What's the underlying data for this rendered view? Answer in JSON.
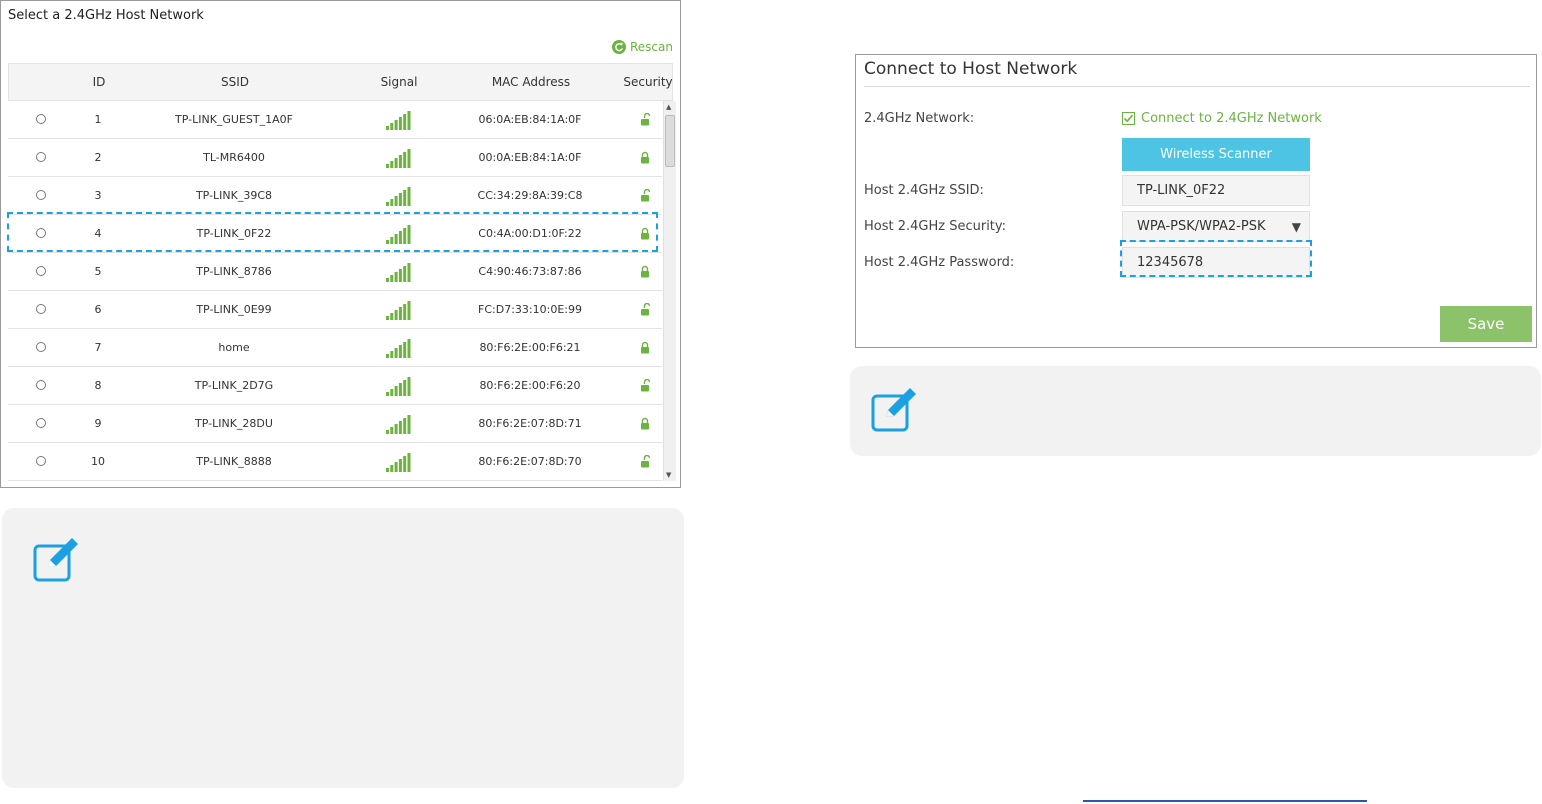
{
  "scanner": {
    "title": "Select a 2.4GHz Host Network",
    "rescan_label": "Rescan",
    "columns": [
      "ID",
      "SSID",
      "Signal",
      "MAC Address",
      "Security"
    ],
    "rows": [
      {
        "id": "1",
        "ssid": "TP-LINK_GUEST_1A0F",
        "mac": "06:0A:EB:84:1A:0F",
        "security": "unlocked"
      },
      {
        "id": "2",
        "ssid": "TL-MR6400",
        "mac": "00:0A:EB:84:1A:0F",
        "security": "locked"
      },
      {
        "id": "3",
        "ssid": "TP-LINK_39C8",
        "mac": "CC:34:29:8A:39:C8",
        "security": "unlocked"
      },
      {
        "id": "4",
        "ssid": "TP-LINK_0F22",
        "mac": "C0:4A:00:D1:0F:22",
        "security": "locked"
      },
      {
        "id": "5",
        "ssid": "TP-LINK_8786",
        "mac": "C4:90:46:73:87:86",
        "security": "locked"
      },
      {
        "id": "6",
        "ssid": "TP-LINK_0E99",
        "mac": "FC:D7:33:10:0E:99",
        "security": "unlocked"
      },
      {
        "id": "7",
        "ssid": "home",
        "mac": "80:F6:2E:00:F6:21",
        "security": "locked"
      },
      {
        "id": "8",
        "ssid": "TP-LINK_2D7G",
        "mac": "80:F6:2E:00:F6:20",
        "security": "unlocked"
      },
      {
        "id": "9",
        "ssid": "TP-LINK_28DU",
        "mac": "80:F6:2E:07:8D:71",
        "security": "locked"
      },
      {
        "id": "10",
        "ssid": "TP-LINK_8888",
        "mac": "80:F6:2E:07:8D:70",
        "security": "unlocked"
      }
    ],
    "selected_id": "4"
  },
  "connect": {
    "title": "Connect to Host Network",
    "network_label": "2.4GHz Network:",
    "connect_checkbox_label": "Connect to 2.4GHz Network",
    "connect_checked": true,
    "wireless_scanner_label": "Wireless Scanner",
    "ssid_label": "Host 2.4GHz SSID:",
    "ssid_value": "TP-LINK_0F22",
    "security_label": "Host 2.4GHz Security:",
    "security_value": "WPA-PSK/WPA2-PSK",
    "password_label": "Host 2.4GHz Password:",
    "password_value": "12345678",
    "save_label": "Save"
  },
  "colors": {
    "accent_green": "#6cb33f",
    "scanner_button_blue": "#4dc4e4",
    "save_button_green": "#8cc36a",
    "highlight_blue": "#1ba1e2",
    "note_background": "#f2f2f2"
  },
  "icons": {
    "rescan": "refresh-icon",
    "signal": "signal-bars-icon",
    "security_locked": "lock-icon",
    "security_unlocked": "unlock-icon",
    "note": "edit-note-icon",
    "select_caret": "caret-down-icon"
  }
}
